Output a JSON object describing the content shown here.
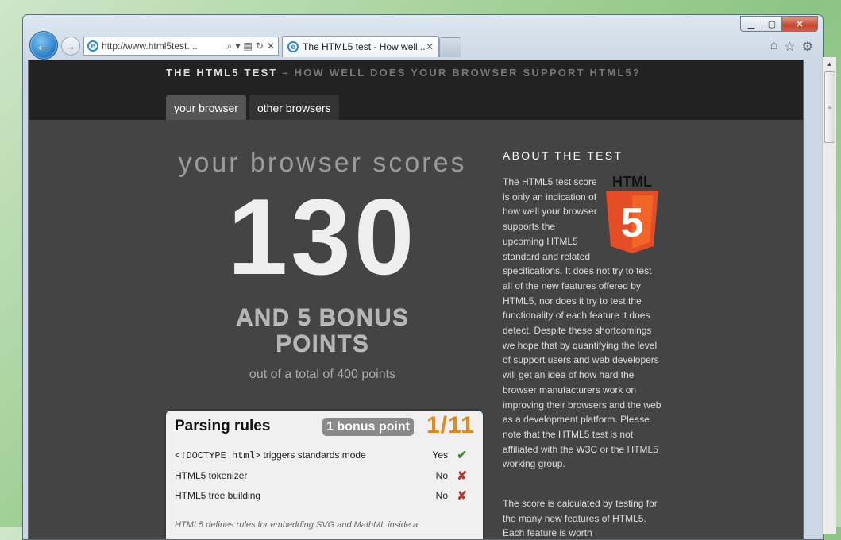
{
  "browser": {
    "address_url": "http://www.html5test....",
    "tab_title": "The HTML5 test - How well...",
    "window_buttons": {
      "minimize": "▁",
      "maximize": "▢",
      "close": "✕"
    }
  },
  "site": {
    "title_strong": "THE HTML5 TEST",
    "title_rest": " – HOW WELL DOES YOUR BROWSER SUPPORT HTML5?",
    "nav": [
      "your browser",
      "other browsers"
    ]
  },
  "score": {
    "lead": "your browser scores",
    "value": "130",
    "bonus_line1": "AND 5 BONUS",
    "bonus_line2": "POINTS",
    "total": "out of a total of 400 points"
  },
  "section": {
    "title": "Parsing rules",
    "bonus_badge": "1 bonus point",
    "fraction": "1/11",
    "rows": [
      {
        "code": "<!DOCTYPE html>",
        "name": " triggers standards mode",
        "result": "Yes",
        "status": "pass"
      },
      {
        "code": "",
        "name": "HTML5 tokenizer",
        "result": "No",
        "status": "fail"
      },
      {
        "code": "",
        "name": "HTML5 tree building",
        "result": "No",
        "status": "fail"
      }
    ],
    "note": "HTML5 defines rules for embedding SVG and MathML inside a"
  },
  "about": {
    "heading": "ABOUT THE TEST",
    "logo_text": "HTML",
    "logo_number": "5",
    "para1": "The HTML5 test score is only an indication of how well your browser supports the upcoming HTML5 standard and related specifications. It does not try to test all of the new features offered by HTML5, nor does it try to test the functionality of each feature it does detect. Despite these shortcomings we hope that by quantifying the level of support users and web developers will get an idea of how hard the browser manufacturers work on improving their browsers and the web as a development platform. Please note that the HTML5 test is not affiliated with the W3C or the HTML5 working group.",
    "para2": "The score is calculated by testing for the many new features of HTML5. Each feature is worth"
  },
  "colors": {
    "pass": "#3a8a2a",
    "fail": "#b03a2e",
    "accent": "#e08a1e",
    "logo": "#e44d26"
  }
}
